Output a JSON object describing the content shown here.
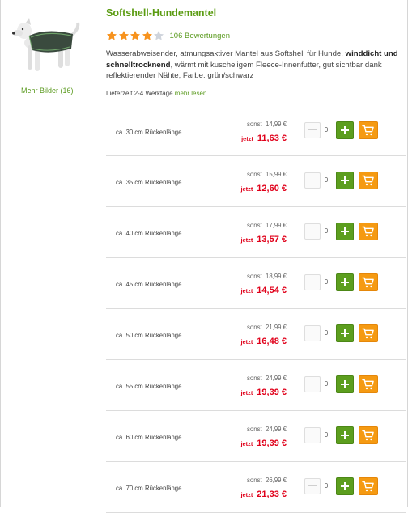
{
  "product": {
    "title": "Softshell-Hundemantel",
    "rating_value": 4,
    "rating_max": 5,
    "reviews": "106 Bewertungen",
    "more_images": "Mehr Bilder (16)",
    "description_part1": "Wasserabweisender, atmungsaktiver Mantel aus Softshell für Hunde, ",
    "description_bold": "winddicht und schnelltrocknend",
    "description_part2": ", wärmt mit kuscheligem Fleece-Innenfutter, gut sichtbar dank reflektierender Nähte; Farbe: grün/schwarz",
    "delivery_label": "Lieferzeit 2-4 Werktage",
    "delivery_link": "mehr lesen"
  },
  "colors": {
    "accent_green": "#5b9c12",
    "price_red": "#e0001a",
    "cart_orange": "#f59a12"
  },
  "labels": {
    "was_prefix": "sonst",
    "now_prefix": "jetzt"
  },
  "variants": [
    {
      "size": "ca. 30 cm Rückenlänge",
      "was": "14,99 €",
      "now": "11,63 €",
      "qty": "0"
    },
    {
      "size": "ca. 35 cm Rückenlänge",
      "was": "15,99 €",
      "now": "12,60 €",
      "qty": "0"
    },
    {
      "size": "ca. 40 cm Rückenlänge",
      "was": "17,99 €",
      "now": "13,57 €",
      "qty": "0"
    },
    {
      "size": "ca. 45 cm Rückenlänge",
      "was": "18,99 €",
      "now": "14,54 €",
      "qty": "0"
    },
    {
      "size": "ca. 50 cm Rückenlänge",
      "was": "21,99 €",
      "now": "16,48 €",
      "qty": "0"
    },
    {
      "size": "ca. 55 cm Rückenlänge",
      "was": "24,99 €",
      "now": "19,39 €",
      "qty": "0"
    },
    {
      "size": "ca. 60 cm Rückenlänge",
      "was": "24,99 €",
      "now": "19,39 €",
      "qty": "0"
    },
    {
      "size": "ca. 70 cm Rückenlänge",
      "was": "26,99 €",
      "now": "21,33 €",
      "qty": "0"
    }
  ]
}
